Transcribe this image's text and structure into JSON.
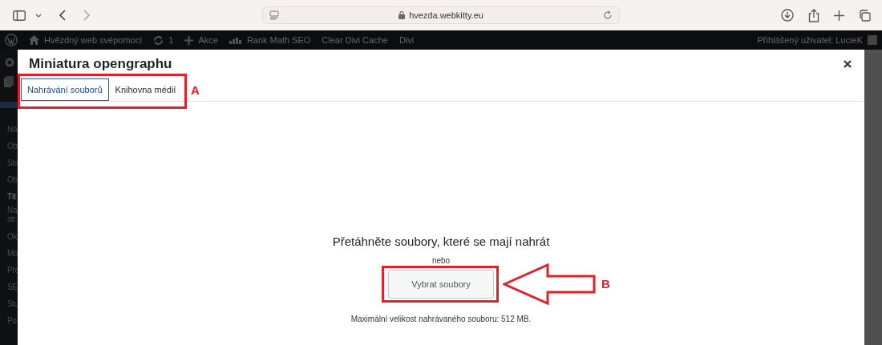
{
  "browser": {
    "url": "hvezda.webkitty.eu"
  },
  "admin_bar": {
    "site": "Hvězdný web svépomocí",
    "updates": "1",
    "new": "Akce",
    "seo": "Rank Math SEO",
    "cache": "Clear Divi Cache",
    "divi": "Divi",
    "user": "Přihlášený uživatel: LucieK"
  },
  "sidebar": {
    "items": [
      {
        "label": "Ná",
        "bold": false
      },
      {
        "label": "Ob",
        "bold": false
      },
      {
        "label": "Sta",
        "bold": false
      },
      {
        "label": "Ob",
        "bold": false
      },
      {
        "label": "Tit",
        "bold": true
      },
      {
        "label": "Na",
        "bold": false
      },
      {
        "label": "str",
        "bold": false
      },
      {
        "label": "Ok",
        "bold": false
      },
      {
        "label": "Mo",
        "bold": false
      },
      {
        "label": "Pře",
        "bold": false
      },
      {
        "label": "SE",
        "bold": false
      },
      {
        "label": "Stu",
        "bold": false
      },
      {
        "label": "Po",
        "bold": false
      }
    ]
  },
  "modal": {
    "title": "Miniatura opengraphu",
    "tabs": [
      {
        "label": "Nahrávání souborů",
        "selected": true
      },
      {
        "label": "Knihovna médií",
        "selected": false
      }
    ],
    "drop_text": "Přetáhněte soubory, které se mají nahrát",
    "or": "nebo",
    "button": "Vybrat soubory",
    "max_size": "Maximální velikost nahrávaného souboru: 512 MB."
  },
  "annotations": [
    {
      "letter": "A",
      "kind": "box"
    },
    {
      "letter": "B",
      "kind": "arrow"
    }
  ]
}
